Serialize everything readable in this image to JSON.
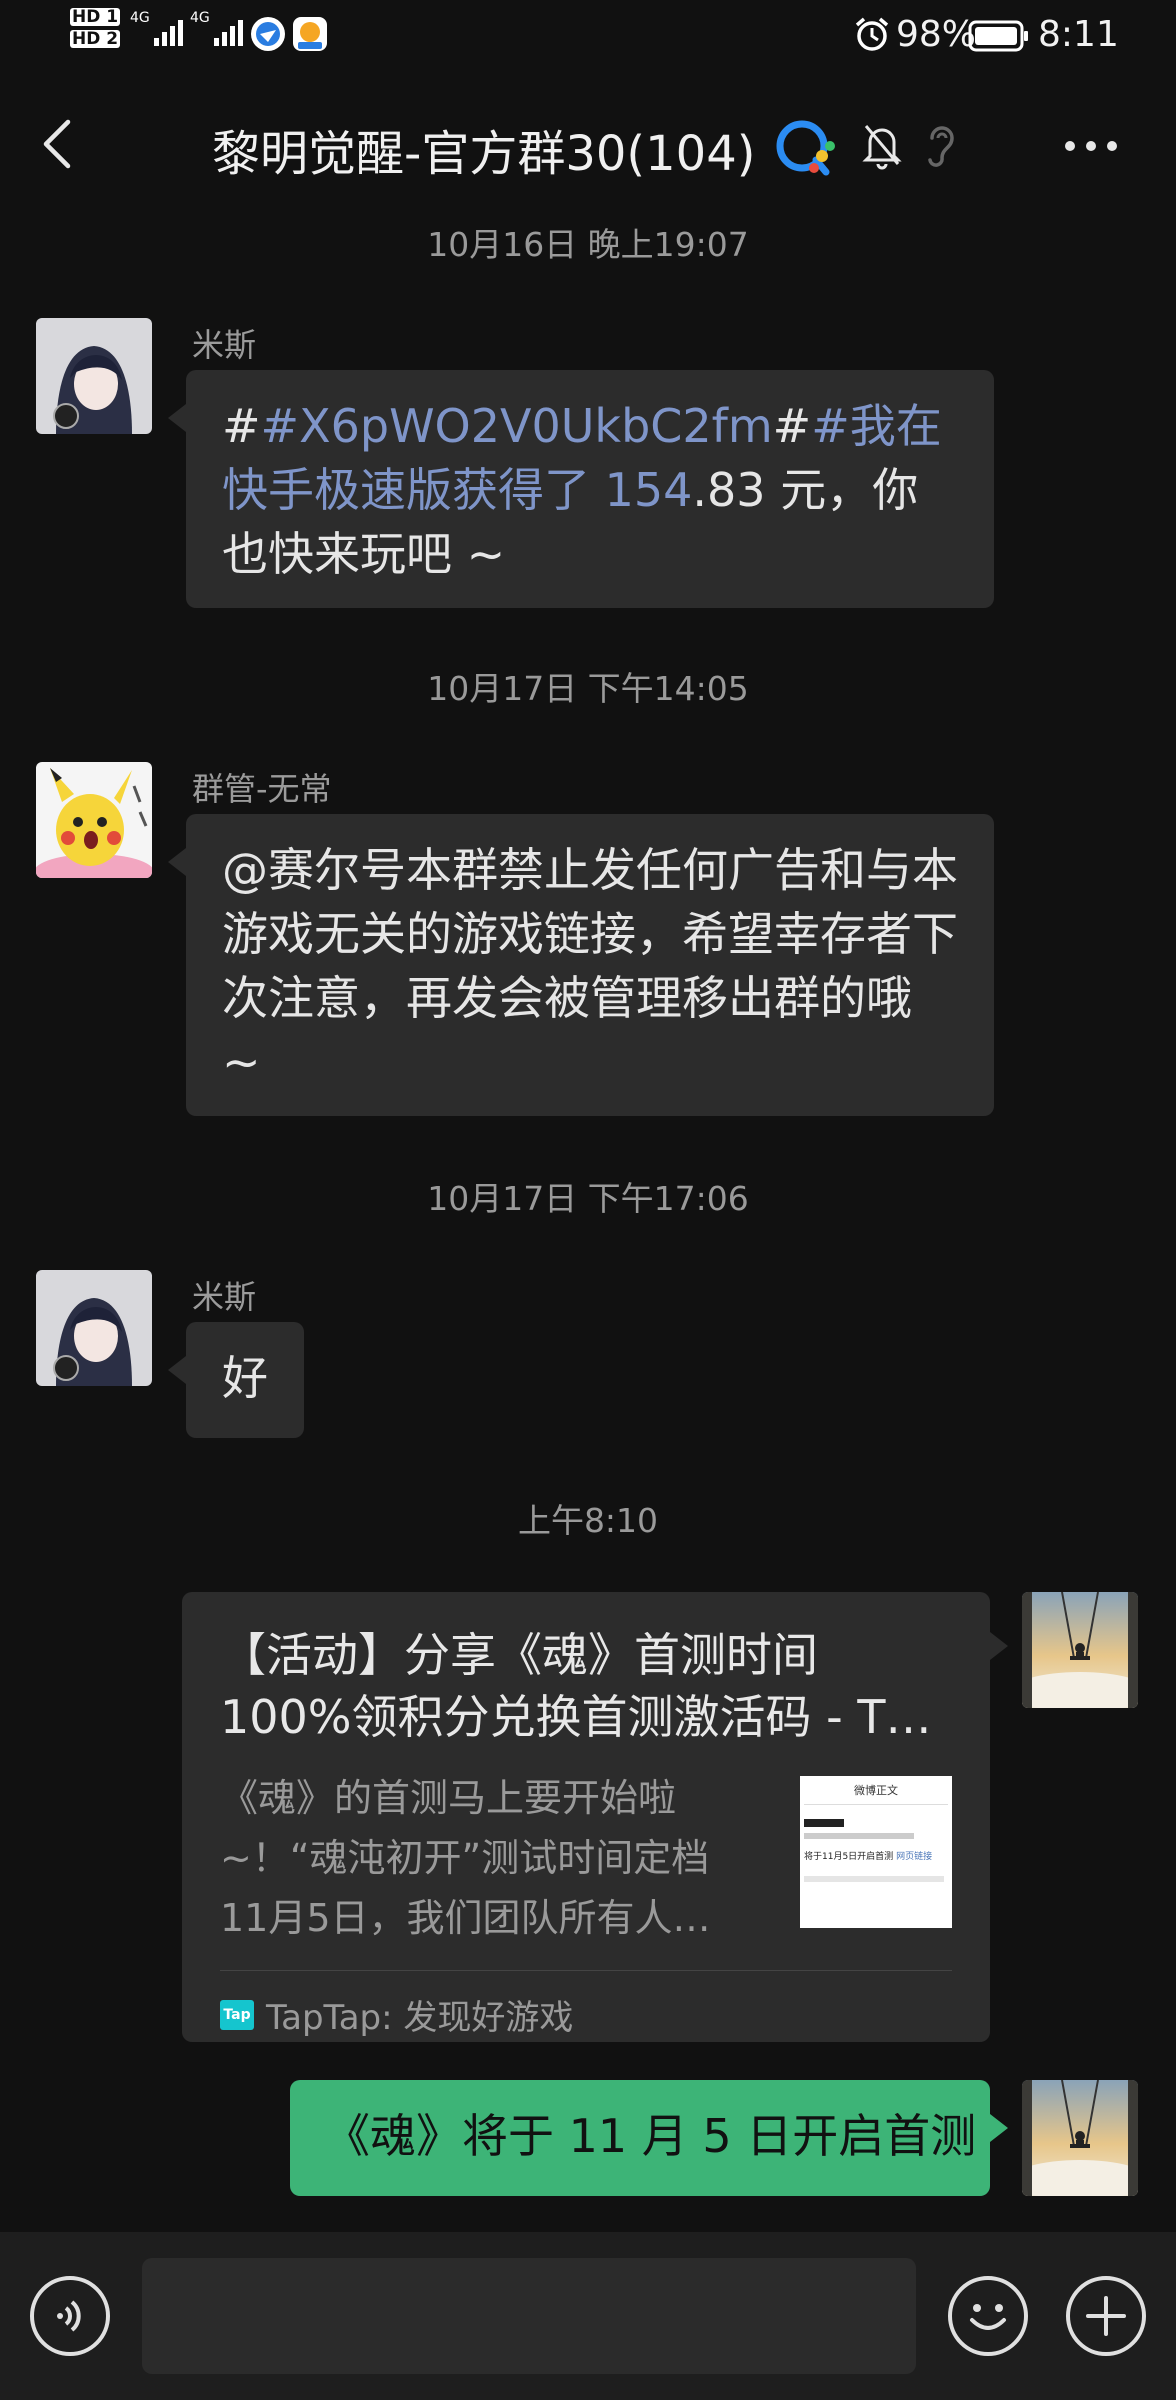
{
  "status_bar": {
    "sim1": "HD 1",
    "sim2": "HD 2",
    "net1": "4G",
    "net2": "4G",
    "battery": "98%",
    "time": "8:11"
  },
  "header": {
    "title": "黎明觉醒-官方群30(104)"
  },
  "messages": [
    {
      "timestamp": "10月16日 晚上19:07",
      "sender": "米斯",
      "text_parts": [
        "#",
        "#X6pWO2V0UkbC2fm",
        "#",
        "#我在快手极速版获得了 154",
        ".83 元，你也快来玩吧 ~"
      ]
    },
    {
      "timestamp": "10月17日 下午14:05",
      "sender": "群管-无常",
      "text": "@赛尔号本群禁止发任何广告和与本游戏无关的游戏链接，希望幸存者下次注意，再发会被管理移出群的哦 ~"
    },
    {
      "timestamp": "10月17日 下午17:06",
      "sender": "米斯",
      "text": "好"
    },
    {
      "timestamp": "上午8:10",
      "card": {
        "title": "【活动】分享《魂》首测时间100%领积分兑换首测激活码 - T…",
        "description": "《魂》的首测马上要开始啦~！“魂沌初开”测试时间定档11月5日，我们团队所有人…",
        "thumb_header": "微博正文",
        "thumb_caption": "将于11月5日开启首测",
        "thumb_link": "网页链接",
        "source_logo": "Tap",
        "source": "TapTap: 发现好游戏"
      }
    },
    {
      "text": "《魂》将于 11 月 5 日开启首测"
    }
  ],
  "colors": {
    "background": "#111111",
    "bubble": "#2c2c2c",
    "self_bubble": "#3db477",
    "link": "#7f95c9"
  }
}
